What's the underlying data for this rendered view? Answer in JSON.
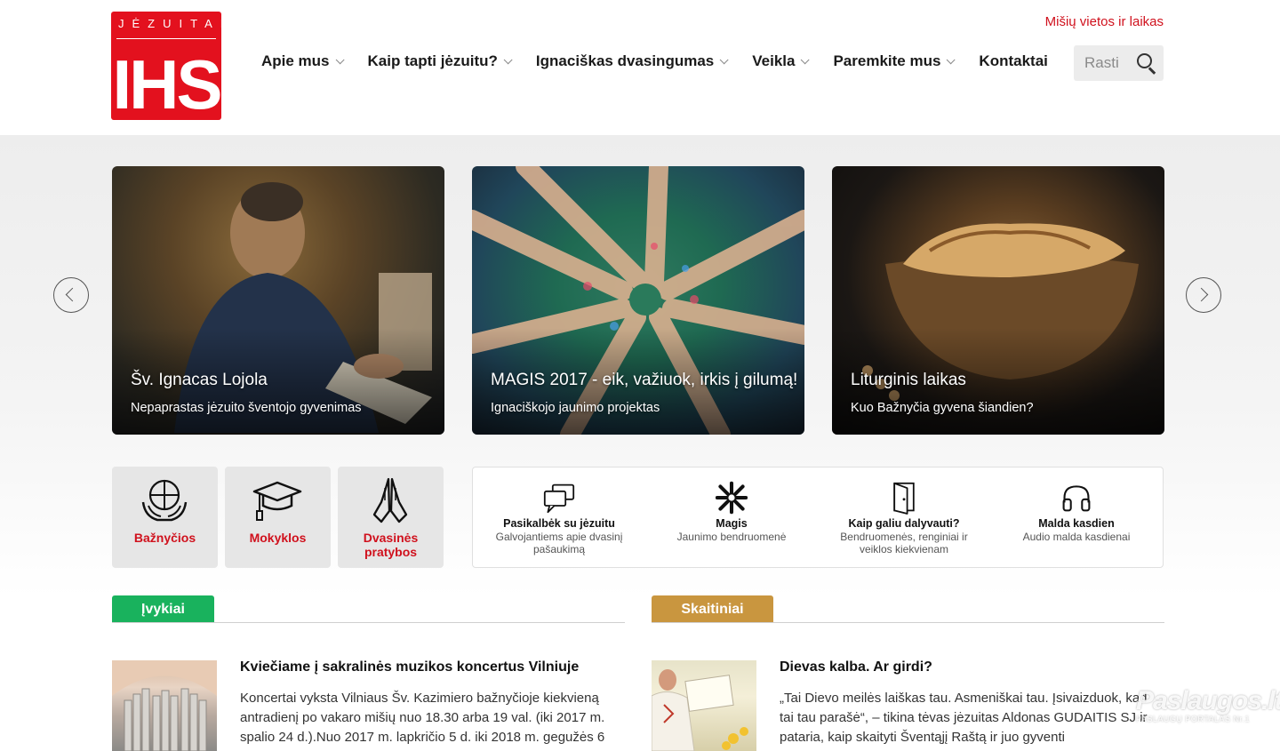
{
  "logo": {
    "top_text": "JĖZUITAI",
    "monogram": "IHS"
  },
  "header": {
    "top_link": "Mišių vietos ir laikas",
    "nav": [
      {
        "label": "Apie mus",
        "has_dropdown": true
      },
      {
        "label": "Kaip tapti jėzuitu?",
        "has_dropdown": true
      },
      {
        "label": "Ignaciškas dvasingumas",
        "has_dropdown": true
      },
      {
        "label": "Veikla",
        "has_dropdown": true
      },
      {
        "label": "Paremkite mus",
        "has_dropdown": true
      },
      {
        "label": "Kontaktai",
        "has_dropdown": false
      }
    ],
    "search": {
      "placeholder": "Rasti",
      "icon": "search-icon"
    }
  },
  "slider": {
    "slides": [
      {
        "title": "Šv. Ignacas Lojola",
        "subtitle": "Nepaprastas jėzuito šventojo gyvenimas"
      },
      {
        "title": "MAGIS 2017 - eik, važiuok, irkis į gilumą!",
        "subtitle": "Ignaciškojo jaunimo projektas"
      },
      {
        "title": "Liturginis laikas",
        "subtitle": "Kuo Bažnyčia gyvena šiandien?"
      }
    ],
    "prev_icon": "chevron-left-icon",
    "next_icon": "chevron-right-icon"
  },
  "tiles": [
    {
      "label": "Bažnyčios",
      "icon": "globe-hands-icon"
    },
    {
      "label": "Mokyklos",
      "icon": "graduation-cap-icon"
    },
    {
      "label": "Dvasinės pratybos",
      "icon": "praying-hands-icon"
    }
  ],
  "panel": [
    {
      "title": "Pasikalbėk su jėzuitu",
      "subtitle": "Galvojantiems apie dvasinį pašaukimą",
      "icon": "chat-bubbles-icon"
    },
    {
      "title": "Magis",
      "subtitle": "Jaunimo bendruomenė",
      "icon": "magis-hands-icon"
    },
    {
      "title": "Kaip galiu dalyvauti?",
      "subtitle": "Bendruomenės, renginiai ir veiklos kiekvienam",
      "icon": "open-door-icon"
    },
    {
      "title": "Malda kasdien",
      "subtitle": "Audio malda kasdienai",
      "icon": "headphones-icon"
    }
  ],
  "sections": {
    "events": {
      "tab": "Įvykiai",
      "color": "#19b25d",
      "article": {
        "title": "Kviečiame į sakralinės muzikos koncertus Vilniuje",
        "text": "Koncertai vyksta Vilniaus Šv. Kazimiero bažnyčioje kiekvieną antradienį po vakaro mišių nuo 18.30 arba 19 val. (iki 2017 m. spalio 24 d.).Nuo 2017 m. lapkričio 5 d. iki 2018 m. gegužės 6"
      }
    },
    "readings": {
      "tab": "Skaitiniai",
      "color": "#c9963f",
      "article": {
        "title": "Dievas kalba. Ar girdi?",
        "text": "„Tai Dievo meilės laiškas tau. Asmeniškai tau. Įsivaizduok, kad tai tau parašė“, – tikina tėvas jėzuitas Aldonas GUDAITIS SJ ir pataria, kaip skaityti Šventąjį Raštą ir juo gyventi"
      }
    }
  },
  "watermark": {
    "line1": "Paslaugos.lt",
    "line2": "PASLAUGŲ PORTALAS Nr.1"
  },
  "colors": {
    "brand_red": "#e3111e",
    "events_green": "#19b25d",
    "readings_gold": "#c9963f"
  }
}
